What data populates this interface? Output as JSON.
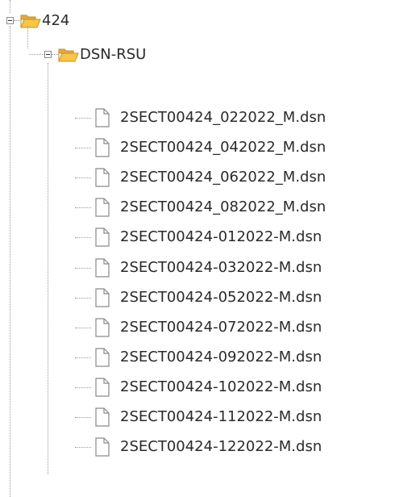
{
  "tree": {
    "root_folder": {
      "label": "424",
      "icon": "folder-open-icon",
      "expanded": true
    },
    "sub_folder": {
      "label": "DSN-RSU",
      "icon": "folder-open-icon",
      "expanded": true
    },
    "files": [
      "2SECT00424_022022_M.dsn",
      "2SECT00424_042022_M.dsn",
      "2SECT00424_062022_M.dsn",
      "2SECT00424_082022_M.dsn",
      "2SECT00424-012022-M.dsn",
      "2SECT00424-032022-M.dsn",
      "2SECT00424-052022-M.dsn",
      "2SECT00424-072022-M.dsn",
      "2SECT00424-092022-M.dsn",
      "2SECT00424-102022-M.dsn",
      "2SECT00424-112022-M.dsn",
      "2SECT00424-122022-M.dsn"
    ],
    "file_icon": "document-icon",
    "colors": {
      "folder_fill": "#f7c64b",
      "folder_edge": "#c8901a",
      "file_edge": "#8a8a8a",
      "connector": "#9a9a9a"
    }
  }
}
